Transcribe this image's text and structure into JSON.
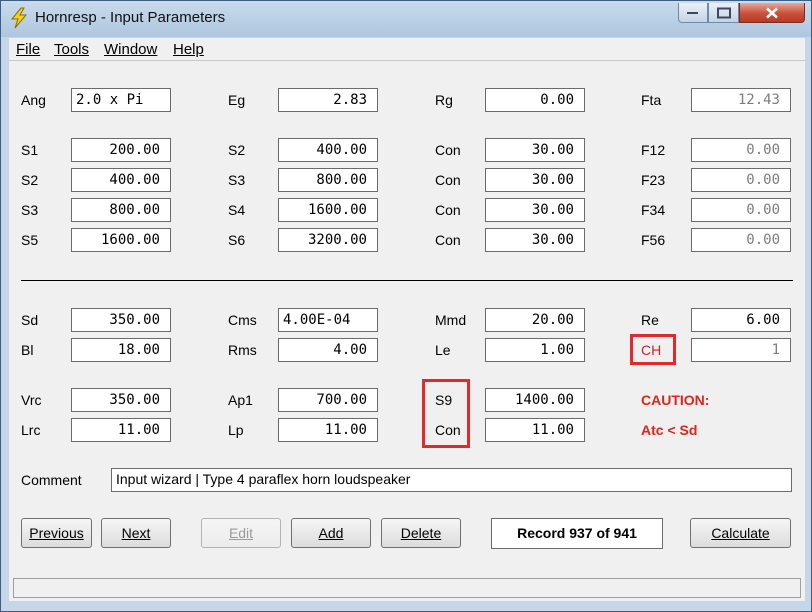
{
  "window": {
    "title": "Hornresp - Input Parameters"
  },
  "menu": [
    "File",
    "Tools",
    "Window",
    "Help"
  ],
  "row_general": [
    {
      "label": "Ang",
      "value": "2.0 x Pi"
    },
    {
      "label": "Eg",
      "value": "2.83"
    },
    {
      "label": "Rg",
      "value": "0.00"
    },
    {
      "label": "Fta",
      "value": "12.43"
    }
  ],
  "horn": [
    [
      {
        "label": "S1",
        "value": "200.00"
      },
      {
        "label": "S2",
        "value": "400.00"
      },
      {
        "label": "Con",
        "value": "30.00"
      },
      {
        "label": "F12",
        "value": "0.00"
      }
    ],
    [
      {
        "label": "S2",
        "value": "400.00"
      },
      {
        "label": "S3",
        "value": "800.00"
      },
      {
        "label": "Con",
        "value": "30.00"
      },
      {
        "label": "F23",
        "value": "0.00"
      }
    ],
    [
      {
        "label": "S3",
        "value": "800.00"
      },
      {
        "label": "S4",
        "value": "1600.00"
      },
      {
        "label": "Con",
        "value": "30.00"
      },
      {
        "label": "F34",
        "value": "0.00"
      }
    ],
    [
      {
        "label": "S5",
        "value": "1600.00"
      },
      {
        "label": "S6",
        "value": "3200.00"
      },
      {
        "label": "Con",
        "value": "30.00"
      },
      {
        "label": "F56",
        "value": "0.00"
      }
    ]
  ],
  "driver": [
    [
      {
        "label": "Sd",
        "value": "350.00"
      },
      {
        "label": "Cms",
        "value": "4.00E-04"
      },
      {
        "label": "Mmd",
        "value": "20.00"
      },
      {
        "label": "Re",
        "value": "6.00"
      }
    ],
    [
      {
        "label": "Bl",
        "value": "18.00"
      },
      {
        "label": "Rms",
        "value": "4.00"
      },
      {
        "label": "Le",
        "value": "1.00"
      },
      {
        "label": "CH",
        "value": "1"
      }
    ]
  ],
  "chamber": [
    [
      {
        "label": "Vrc",
        "value": "350.00"
      },
      {
        "label": "Ap1",
        "value": "700.00"
      },
      {
        "label": "S9",
        "value": "1400.00"
      }
    ],
    [
      {
        "label": "Lrc",
        "value": "11.00"
      },
      {
        "label": "Lp",
        "value": "11.00"
      },
      {
        "label": "Con",
        "value": "11.00"
      }
    ]
  ],
  "caution": {
    "title": "CAUTION:",
    "message": "Atc < Sd"
  },
  "comment": {
    "label": "Comment",
    "value": "Input wizard | Type 4 paraflex horn loudspeaker"
  },
  "buttons": {
    "previous": "Previous",
    "next": "Next",
    "edit": "Edit",
    "add": "Add",
    "delete": "Delete",
    "calculate": "Calculate"
  },
  "record": "Record 937 of 941",
  "colors": {
    "highlight": "#e22a2a",
    "caution": "#e2231a"
  }
}
